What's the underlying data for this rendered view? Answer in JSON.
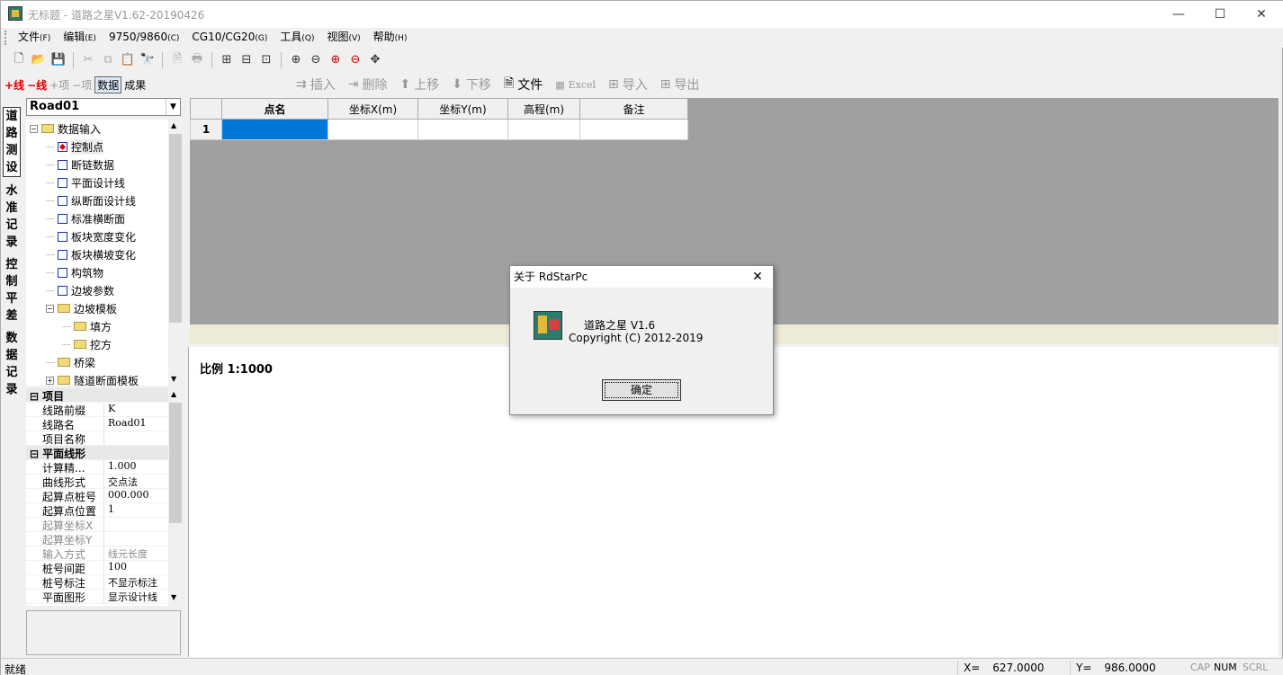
{
  "window": {
    "title": "无标题 - 道路之星V1.62-20190426",
    "controls": {
      "minimize": "—",
      "maximize": "☐",
      "close": "✕"
    }
  },
  "menu": [
    {
      "label": "文件",
      "key": "(F)"
    },
    {
      "label": "编辑",
      "key": "(E)"
    },
    {
      "label": "9750/9860",
      "key": "(C)"
    },
    {
      "label": "CG10/CG20",
      "key": "(G)"
    },
    {
      "label": "工具",
      "key": "(Q)"
    },
    {
      "label": "视图",
      "key": "(V)"
    },
    {
      "label": "帮助",
      "key": "(H)"
    }
  ],
  "left_toolbar": {
    "add_line": "+线",
    "remove_line": "−线",
    "add_item": "+项",
    "remove_item": "−项",
    "data": "数据",
    "result": "成果"
  },
  "combo": {
    "value": "Road01"
  },
  "vertical_tabs": [
    "道路测设",
    "水准记录",
    "控制平差",
    "数据记录"
  ],
  "tree": [
    {
      "label": "数据输入",
      "level": 0,
      "type": "folder",
      "expand": "−"
    },
    {
      "label": "控制点",
      "level": 1,
      "type": "checked"
    },
    {
      "label": "断链数据",
      "level": 1,
      "type": "check"
    },
    {
      "label": "平面设计线",
      "level": 1,
      "type": "check"
    },
    {
      "label": "纵断面设计线",
      "level": 1,
      "type": "check"
    },
    {
      "label": "标准横断面",
      "level": 1,
      "type": "check"
    },
    {
      "label": "板块宽度变化",
      "level": 1,
      "type": "check"
    },
    {
      "label": "板块横坡变化",
      "level": 1,
      "type": "check"
    },
    {
      "label": "构筑物",
      "level": 1,
      "type": "check"
    },
    {
      "label": "边坡参数",
      "level": 1,
      "type": "check"
    },
    {
      "label": "边坡模板",
      "level": 1,
      "type": "folder",
      "expand": "−"
    },
    {
      "label": "填方",
      "level": 2,
      "type": "folder"
    },
    {
      "label": "挖方",
      "level": 2,
      "type": "folder"
    },
    {
      "label": "桥梁",
      "level": 1,
      "type": "folder"
    },
    {
      "label": "隧道断面模板",
      "level": 1,
      "type": "folder",
      "expand": "+"
    }
  ],
  "properties": [
    {
      "key": "项目",
      "value": "",
      "cat": true,
      "expand": "⊟"
    },
    {
      "key": "线路前缀",
      "value": "K"
    },
    {
      "key": "线路名",
      "value": "Road01"
    },
    {
      "key": "项目名称",
      "value": ""
    },
    {
      "key": "平面线形",
      "value": "",
      "cat": true,
      "expand": "⊟"
    },
    {
      "key": "计算精...",
      "value": "1.000"
    },
    {
      "key": "曲线形式",
      "value": "交点法"
    },
    {
      "key": "起算点桩号",
      "value": "000.000"
    },
    {
      "key": "起算点位置",
      "value": "1"
    },
    {
      "key": "起算坐标X",
      "value": "",
      "dim": true
    },
    {
      "key": "起算坐标Y",
      "value": "",
      "dim": true
    },
    {
      "key": "输入方式",
      "value": "线元长度",
      "dim": true
    },
    {
      "key": "桩号间距",
      "value": "100"
    },
    {
      "key": "桩号标注",
      "value": "不显示标注"
    },
    {
      "key": "平面图形",
      "value": "显示设计线"
    }
  ],
  "grid_toolbar": {
    "insert": "插入",
    "delete": "删除",
    "move_up": "上移",
    "move_down": "下移",
    "file": "文件",
    "excel": "Excel",
    "import": "导入",
    "export": "导出"
  },
  "grid": {
    "columns": [
      "点名",
      "坐标X(m)",
      "坐标Y(m)",
      "高程(m)",
      "备注"
    ],
    "rows": [
      {
        "num": "1",
        "cells": [
          "",
          "",
          "",
          "",
          ""
        ]
      }
    ]
  },
  "drawing": {
    "scale_label": "比例 1:1000"
  },
  "dialog": {
    "title": "关于 RdStarPc",
    "close": "✕",
    "line1": "道路之星 V1.6",
    "line2": "Copyright (C) 2012-2019",
    "ok": "确定"
  },
  "status": {
    "text": "就绪",
    "x_label": "X=",
    "x_value": "627.0000",
    "y_label": "Y=",
    "y_value": "986.0000",
    "cap": "CAP",
    "num": "NUM",
    "scrl": "SCRL"
  }
}
